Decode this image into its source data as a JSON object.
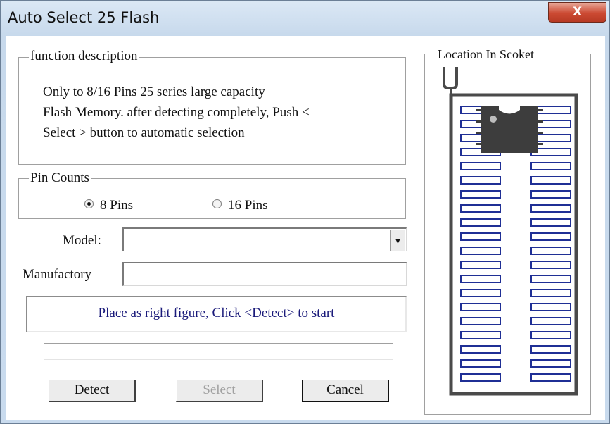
{
  "window": {
    "title": "Auto Select 25 Flash",
    "close_label": "X"
  },
  "function_description": {
    "legend": "function description",
    "lines": [
      "Only to 8/16 Pins 25 series large capacity",
      "Flash Memory. after detecting completely, Push <",
      "Select > button to automatic selection"
    ]
  },
  "pin_counts": {
    "legend": "Pin Counts",
    "options": [
      {
        "label": "8 Pins",
        "selected": true
      },
      {
        "label": "16 Pins",
        "selected": false
      }
    ]
  },
  "model": {
    "label": "Model:",
    "value": ""
  },
  "manufactory": {
    "label": "Manufactory",
    "value": ""
  },
  "status_message": "Place as right figure, Click <Detect> to start",
  "progress": {
    "value": 0
  },
  "buttons": {
    "detect": "Detect",
    "select": "Select",
    "cancel": "Cancel"
  },
  "location": {
    "legend": "Location In Scoket",
    "socket_rows_per_side": 20
  },
  "colors": {
    "socket_outline": "#4a4a4a",
    "pin_slot": "#1f2f95",
    "chip_body": "#3d3d3d",
    "status_text": "#1a1a7a"
  }
}
